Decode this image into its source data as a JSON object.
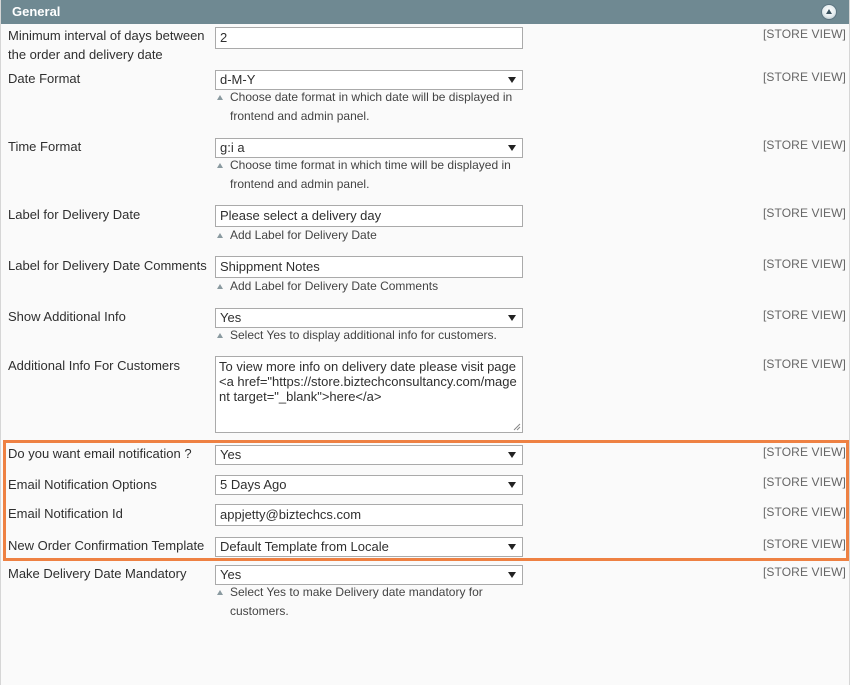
{
  "header": {
    "title": "General"
  },
  "scope_label": "[STORE VIEW]",
  "fields": {
    "min_interval": {
      "label_line1": "Minimum interval of days between",
      "label_line2": "the order and delivery date",
      "value": "2"
    },
    "date_format": {
      "label": "Date Format",
      "value": "d-M-Y",
      "note_line1": "Choose date format in which date will be displayed in",
      "note_line2": "frontend and admin panel."
    },
    "time_format": {
      "label": "Time Format",
      "value": "g:i a",
      "note_line1": "Choose time format in which time will be displayed in",
      "note_line2": "frontend and admin panel."
    },
    "delivery_label": {
      "label": "Label for Delivery Date",
      "value": "Please select a delivery day",
      "note": "Add Label for Delivery Date"
    },
    "comments_label": {
      "label": "Label for Delivery Date Comments",
      "value": "Shippment Notes",
      "note": "Add Label for Delivery Date Comments"
    },
    "show_info": {
      "label": "Show Additional Info",
      "value": "Yes",
      "note": "Select Yes to display additional info for customers."
    },
    "additional_info": {
      "label": "Additional Info For Customers",
      "value": "To view more info on delivery date please visit page <a href=\"https://store.biztechconsultancy.com/magent target=\"_blank\">here</a>"
    },
    "email_notification": {
      "label": "Do you want email notification ?",
      "value": "Yes"
    },
    "email_options": {
      "label": "Email Notification Options",
      "value": "5 Days Ago"
    },
    "email_id": {
      "label": "Email Notification Id",
      "value": "appjetty@biztechcs.com"
    },
    "order_template": {
      "label": "New Order Confirmation Template",
      "value": "Default Template from Locale"
    },
    "mandatory": {
      "label": "Make Delivery Date Mandatory",
      "value": "Yes",
      "note_line1": "Select Yes to make Delivery date mandatory for",
      "note_line2": "customers."
    }
  }
}
